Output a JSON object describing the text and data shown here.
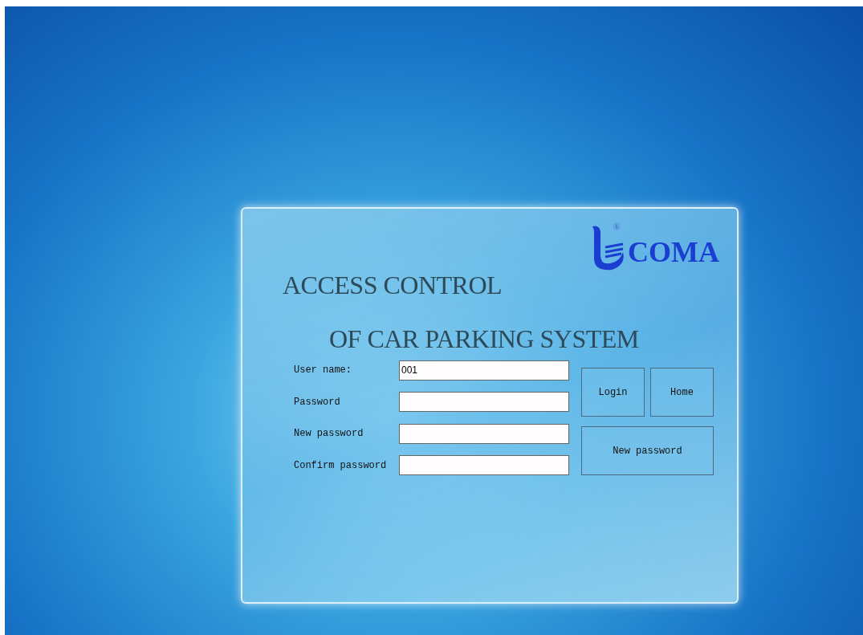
{
  "logo": {
    "text": "COMA",
    "mark": "®"
  },
  "title_lines": [
    "ACCESS CONTROL",
    "OF CAR PARKING SYSTEM"
  ],
  "fields": [
    {
      "label": "User name:",
      "value": "001"
    },
    {
      "label": "Password"
    },
    {
      "label": "New password"
    },
    {
      "label": "Confirm password"
    }
  ],
  "buttons": [
    "Login",
    "Home",
    "New password"
  ]
}
